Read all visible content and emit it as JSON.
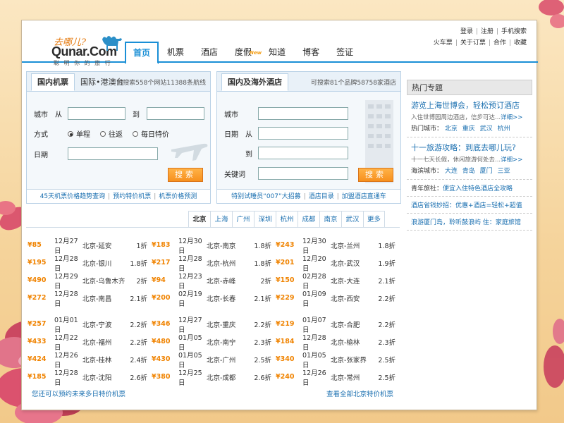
{
  "brand": {
    "slogan": "去哪儿?",
    "name": "Qunar.Com",
    "tagline": "聪 明 你 的 旅 行"
  },
  "toplinks": {
    "row1": [
      "登录",
      "注册",
      "手机搜索"
    ],
    "row2": [
      "火车票",
      "关于订票",
      "合作",
      "收藏"
    ]
  },
  "nav": [
    {
      "label": "首页",
      "active": true
    },
    {
      "label": "机票"
    },
    {
      "label": "酒店"
    },
    {
      "label": "度假",
      "badge": "New"
    },
    {
      "label": "知道"
    },
    {
      "label": "博客"
    },
    {
      "label": "签证"
    }
  ],
  "flight_panel": {
    "tabs": [
      "国内机票",
      "国际•港澳台"
    ],
    "note": "可搜索558个网站11388条航线",
    "city_label": "城市",
    "from_label": "从",
    "to_label": "到",
    "mode_label": "方式",
    "modes": [
      "单程",
      "往返",
      "每日特价"
    ],
    "date_label": "日期",
    "search_button": "搜索",
    "footer_links": [
      "45天机票价格趋势查询",
      "预约特价机票",
      "机票价格预测"
    ]
  },
  "hotel_panel": {
    "tab": "国内及海外酒店",
    "note": "可搜索81个品牌58758家酒店",
    "city_label": "城市",
    "date_label": "日期",
    "from_label": "从",
    "to_label": "到",
    "keyword_label": "关键词",
    "search_button": "搜索",
    "footer_links": [
      "特别试睡员“007”大招募",
      "酒店目录",
      "加盟酒店直通车"
    ]
  },
  "sidebar": {
    "title": "热门专题",
    "block1": {
      "head": "游览上海世博会，轻松预订酒店",
      "desc": "入住世博园周边酒店，信步可达...",
      "more": "详细>>",
      "cities_label": "热门城市：",
      "cities": [
        "北京",
        "重庆",
        "武汉",
        "杭州"
      ]
    },
    "block2": {
      "head": "十一旅游攻略：到底去哪儿玩?",
      "desc": "十一七天长假，休闲旅游何处去...",
      "more": "详细>>",
      "cities_label": "海滨城市：",
      "cities": [
        "大连",
        "青岛",
        "厦门",
        "三亚"
      ]
    },
    "lines": [
      {
        "label": "青年旅社：",
        "text": "便宜入住特色酒店全攻略"
      },
      {
        "label": "酒店省钱妙招：",
        "text": "优惠+酒店=轻松+超值"
      },
      {
        "label": "浪游厦门岛，",
        "text": "聆听鼓浪屿 住：家庭旅馆"
      }
    ]
  },
  "city_tabs": [
    "北京",
    "上海",
    "广州",
    "深圳",
    "杭州",
    "成都",
    "南京",
    "武汉",
    "更多"
  ],
  "deals": [
    [
      [
        {
          "price": "¥85",
          "date": "12月27日",
          "route": "北京-延安",
          "disc": "1折"
        },
        {
          "price": "¥183",
          "date": "12月30日",
          "route": "北京-南京",
          "disc": "1.8折"
        },
        {
          "price": "¥243",
          "date": "12月30日",
          "route": "北京-兰州",
          "disc": "1.8折"
        }
      ],
      [
        {
          "price": "¥195",
          "date": "12月28日",
          "route": "北京-银川",
          "disc": "1.8折"
        },
        {
          "price": "¥217",
          "date": "12月28日",
          "route": "北京-杭州",
          "disc": "1.8折"
        },
        {
          "price": "¥201",
          "date": "12月20日",
          "route": "北京-武汉",
          "disc": "1.9折"
        }
      ],
      [
        {
          "price": "¥490",
          "date": "12月29日",
          "route": "北京-乌鲁木齐",
          "disc": "2折"
        },
        {
          "price": "¥94",
          "date": "12月23日",
          "route": "北京-赤峰",
          "disc": "2折"
        },
        {
          "price": "¥150",
          "date": "02月28日",
          "route": "北京-大连",
          "disc": "2.1折"
        }
      ],
      [
        {
          "price": "¥272",
          "date": "12月28日",
          "route": "北京-南昌",
          "disc": "2.1折"
        },
        {
          "price": "¥200",
          "date": "02月19日",
          "route": "北京-长春",
          "disc": "2.1折"
        },
        {
          "price": "¥229",
          "date": "01月09日",
          "route": "北京-西安",
          "disc": "2.2折"
        }
      ]
    ],
    [
      [
        {
          "price": "¥257",
          "date": "01月01日",
          "route": "北京-宁波",
          "disc": "2.2折"
        },
        {
          "price": "¥346",
          "date": "12月27日",
          "route": "北京-重庆",
          "disc": "2.2折"
        },
        {
          "price": "¥219",
          "date": "01月07日",
          "route": "北京-合肥",
          "disc": "2.2折"
        }
      ],
      [
        {
          "price": "¥433",
          "date": "12月22日",
          "route": "北京-福州",
          "disc": "2.2折"
        },
        {
          "price": "¥480",
          "date": "01月05日",
          "route": "北京-南宁",
          "disc": "2.3折"
        },
        {
          "price": "¥184",
          "date": "12月28日",
          "route": "北京-榆林",
          "disc": "2.3折"
        }
      ],
      [
        {
          "price": "¥424",
          "date": "12月26日",
          "route": "北京-桂林",
          "disc": "2.4折"
        },
        {
          "price": "¥430",
          "date": "01月05日",
          "route": "北京-广州",
          "disc": "2.5折"
        },
        {
          "price": "¥340",
          "date": "01月05日",
          "route": "北京-张家界",
          "disc": "2.5折"
        }
      ],
      [
        {
          "price": "¥185",
          "date": "12月28日",
          "route": "北京-沈阳",
          "disc": "2.6折"
        },
        {
          "price": "¥380",
          "date": "12月25日",
          "route": "北京-成都",
          "disc": "2.6折"
        },
        {
          "price": "¥240",
          "date": "12月26日",
          "route": "北京-常州",
          "disc": "2.5折"
        }
      ]
    ]
  ],
  "deals_footer": {
    "left": "您还可以预约未来多日特价机票",
    "right": "查看全部北京特价机票"
  },
  "colors": {
    "accent": "#1a8fd6",
    "price": "#f08300",
    "link": "#1a6fb0",
    "button": "#f7901e"
  }
}
